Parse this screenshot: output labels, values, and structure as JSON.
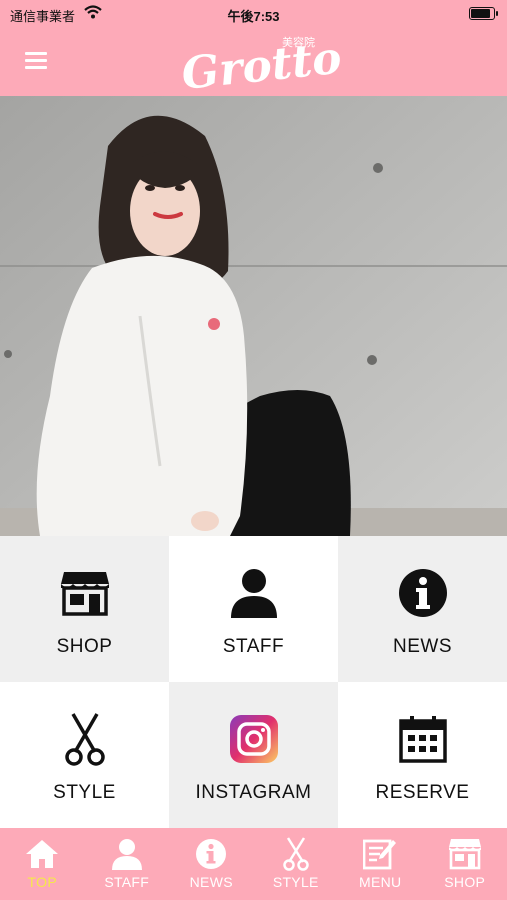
{
  "status_bar": {
    "carrier": "通信事業者",
    "time": "午後7:53"
  },
  "header": {
    "logo_text": "Grotto",
    "logo_sub": "美容院",
    "menu_icon": "hamburger-icon"
  },
  "colors": {
    "brand_pink": "#fdaab8",
    "active_tab": "#f5e84a",
    "tile_grey": "#efefef"
  },
  "grid": [
    {
      "label": "SHOP",
      "icon": "shop-icon"
    },
    {
      "label": "STAFF",
      "icon": "person-icon"
    },
    {
      "label": "NEWS",
      "icon": "info-icon"
    },
    {
      "label": "STYLE",
      "icon": "scissors-icon"
    },
    {
      "label": "INSTAGRAM",
      "icon": "instagram-icon"
    },
    {
      "label": "RESERVE",
      "icon": "calendar-icon"
    }
  ],
  "tabbar": [
    {
      "label": "TOP",
      "icon": "home-icon",
      "active": true
    },
    {
      "label": "STAFF",
      "icon": "person-icon"
    },
    {
      "label": "NEWS",
      "icon": "info-icon"
    },
    {
      "label": "STYLE",
      "icon": "scissors-icon"
    },
    {
      "label": "MENU",
      "icon": "menu-edit-icon"
    },
    {
      "label": "SHOP",
      "icon": "shop-icon"
    }
  ]
}
